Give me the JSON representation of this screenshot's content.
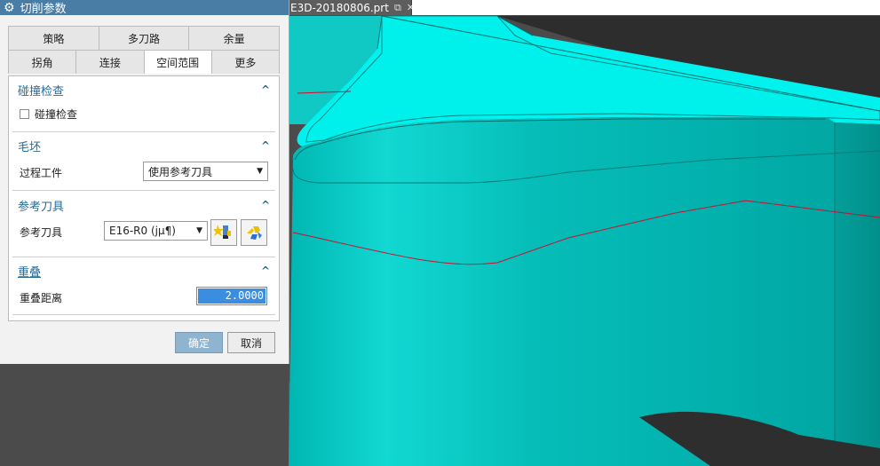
{
  "dialog": {
    "title": "切削参数",
    "tabs_row1": [
      "策略",
      "多刀路",
      "余量"
    ],
    "tabs_row2": [
      "拐角",
      "连接",
      "空间范围",
      "更多"
    ],
    "active_tab": "空间范围",
    "groups": {
      "collision": {
        "header": "碰撞检查",
        "checkbox_label": "碰撞检查",
        "checked": false
      },
      "blank": {
        "header": "毛坯",
        "label": "过程工件",
        "value": "使用参考刀具"
      },
      "ref_tool": {
        "header": "参考刀具",
        "label": "参考刀具",
        "value": "E16-R0 (jµ¶)"
      },
      "overlap": {
        "header": "重叠",
        "label": "重叠距离",
        "value": "2.0000"
      }
    },
    "ok_label": "确定",
    "cancel_label": "取消"
  },
  "document": {
    "tab_title": "E3D-20180806.prt"
  },
  "colors": {
    "title_bar": "#4a7da6",
    "group_header": "#2a6b94",
    "part_face": "#00e0dc",
    "part_side": "#00b4b0",
    "background": "#4b4b4b"
  },
  "icons": {
    "dialog": "gear-icon",
    "group_collapse": "chevron-up-icon",
    "dropdown": "triangle-down-icon",
    "doc_tab": [
      "popout-icon",
      "close-icon"
    ]
  }
}
